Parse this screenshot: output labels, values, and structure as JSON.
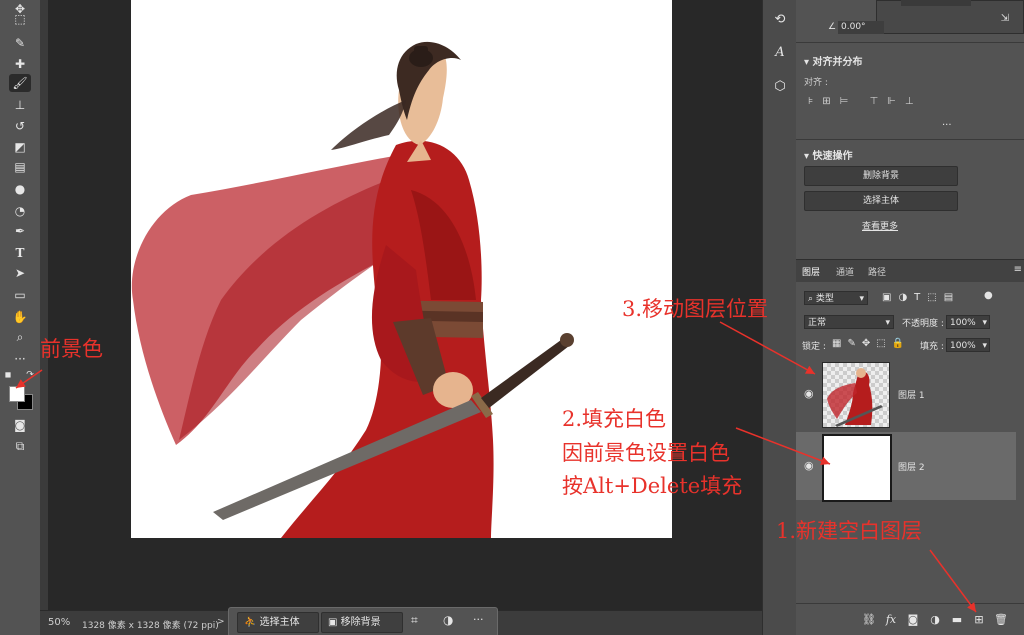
{
  "toolbar": {
    "tools": [
      "move-icon",
      "marquee-icon",
      "lasso-icon",
      "quick-select-icon",
      "crop-icon",
      "frame-icon",
      "eyedropper-icon",
      "healing-icon",
      "brush-icon",
      "stamp-icon",
      "history-brush-icon",
      "eraser-icon",
      "gradient-icon",
      "blur-icon",
      "dodge-icon",
      "pen-icon",
      "type-icon",
      "path-select-icon",
      "rectangle-icon",
      "hand-icon",
      "zoom-icon",
      "more-icon"
    ],
    "foreground_color": "#ffffff",
    "background_color": "#000000"
  },
  "status": {
    "zoom": "50%",
    "doc_info": "1328 像素 x 1328 像素 (72 ppi)",
    "arrow": ">"
  },
  "context_bar": {
    "select_subject": "选择主体",
    "remove_bg": "移除背景",
    "more": "···"
  },
  "properties": {
    "angle": "0.00°",
    "align_section": "对齐并分布",
    "align_label": "对齐 :",
    "more": "···",
    "quick_section": "快速操作",
    "remove_bg": "删除背景",
    "select_subject": "选择主体",
    "see_more": "查看更多"
  },
  "layers_panel": {
    "tabs": [
      "图层",
      "通道",
      "路径"
    ],
    "kind_filter": "类型",
    "blend_mode": "正常",
    "opacity_label": "不透明度 :",
    "opacity_value": "100%",
    "lock_label": "锁定 :",
    "fill_label": "填充 :",
    "fill_value": "100%",
    "layers": [
      {
        "name": "图层 1",
        "thumb": "figure"
      },
      {
        "name": "图层 2",
        "thumb": "white"
      }
    ],
    "bottom_icons": [
      "link-icon",
      "fx-icon",
      "mask-icon",
      "adjustment-icon",
      "folder-icon",
      "new-layer-icon",
      "trash-icon"
    ]
  },
  "annotations": {
    "foreground": "前景色",
    "step3": "3.移动图层位置",
    "step2_line1": "2.填充白色",
    "step2_line2": "因前景色设置白色",
    "step2_line3": "按Alt+Delete填充",
    "step1": "1.新建空白图层"
  },
  "colors": {
    "annotation": "#e8322b",
    "robe": "#b31d1d"
  }
}
